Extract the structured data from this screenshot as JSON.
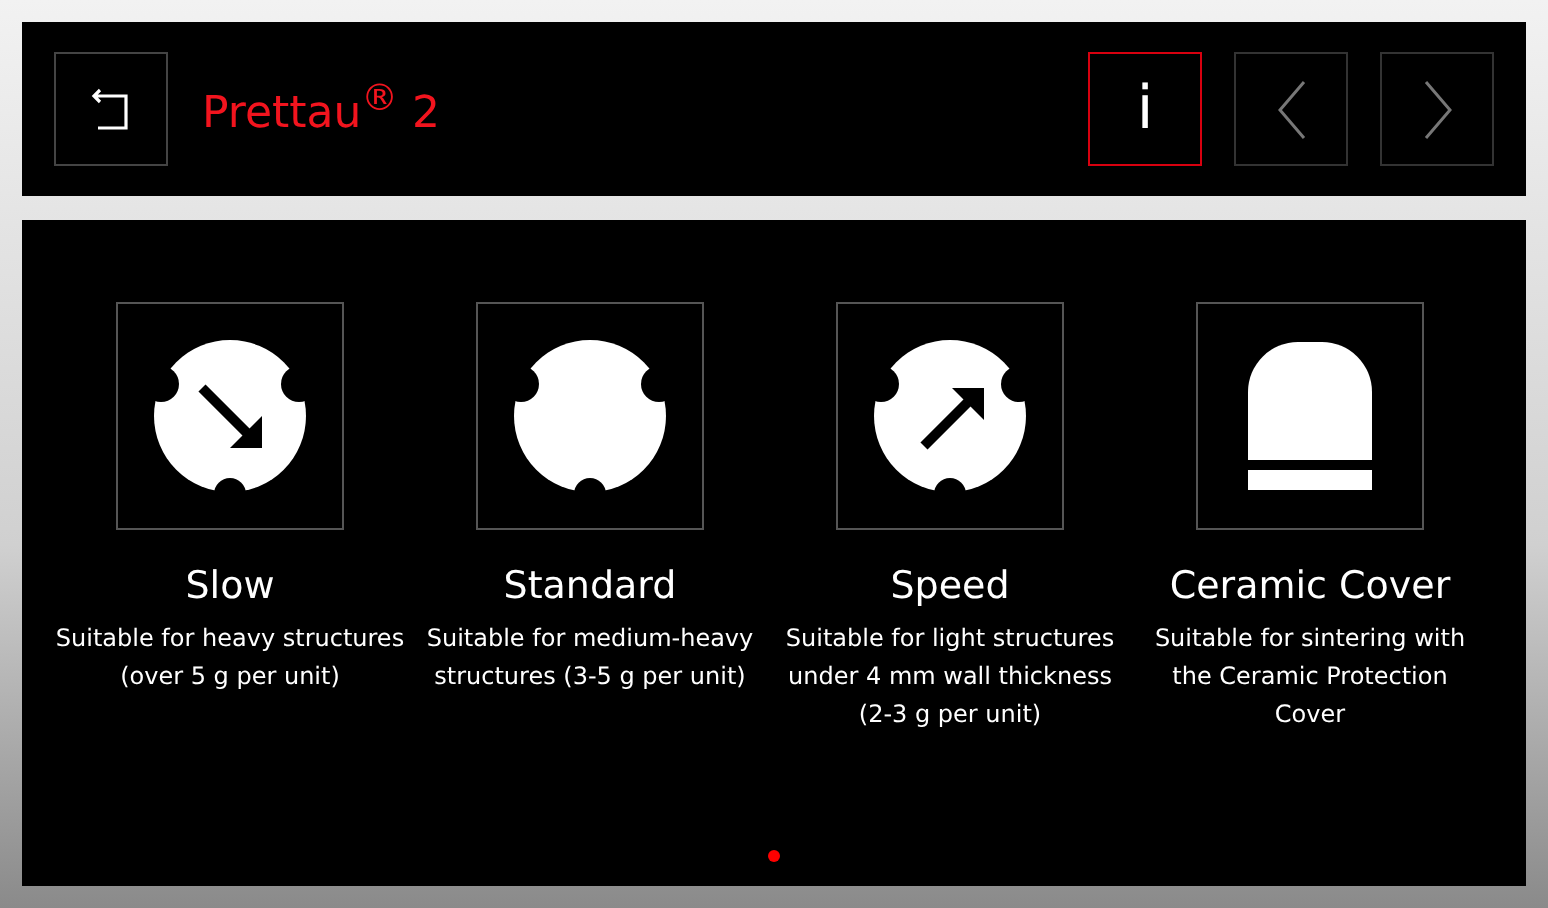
{
  "header": {
    "title": "Prettau$^{®}$ 2",
    "buttons": [
      {
        "kind": "back",
        "selected": false
      },
      {
        "kind": "info",
        "label": "i",
        "selected": true
      },
      {
        "kind": "prev",
        "selected": false
      },
      {
        "kind": "next",
        "selected": false
      }
    ]
  },
  "modes": [
    {
      "kind": "slow",
      "name": "Slow",
      "description": "Suitable for heavy structures (over 5 g per unit)"
    },
    {
      "kind": "standard",
      "name": "Standard",
      "description": "Suitable for medium-heavy structures (3-5 g per unit)"
    },
    {
      "kind": "speed",
      "name": "Speed",
      "description": "Suitable for light structures under 4 mm wall thickness (2-3 g per unit)"
    },
    {
      "kind": "cover",
      "name": "Ceramic Cover",
      "description": "Suitable for sintering with the Ceramic Protection Cover"
    }
  ],
  "pages": [
    {
      "selected": true
    }
  ]
}
